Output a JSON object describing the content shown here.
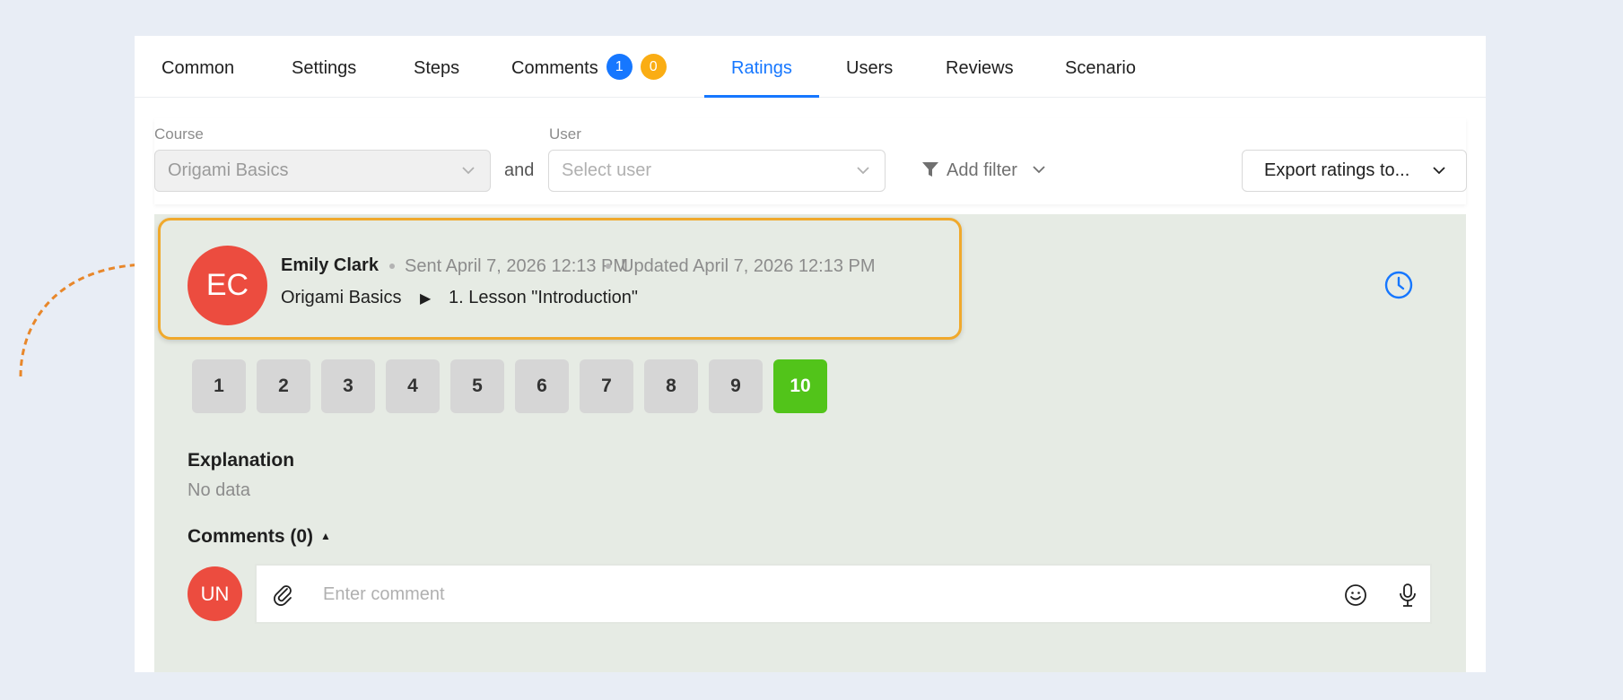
{
  "tabs": [
    {
      "label": "Common"
    },
    {
      "label": "Settings"
    },
    {
      "label": "Steps"
    },
    {
      "label": "Comments",
      "badges": [
        "1",
        "0"
      ]
    },
    {
      "label": "Ratings",
      "active": true
    },
    {
      "label": "Users"
    },
    {
      "label": "Reviews"
    },
    {
      "label": "Scenario"
    }
  ],
  "filters": {
    "course_label": "Course",
    "course_value": "Origami Basics",
    "and_label": "and",
    "user_label": "User",
    "user_placeholder": "Select user",
    "add_filter_label": "Add filter",
    "export_label": "Export ratings to..."
  },
  "rating": {
    "avatar_initials": "EC",
    "author": "Emily Clark",
    "sent": "Sent April 7, 2026 12:13 PM",
    "updated": "Updated April 7, 2026 12:13 PM",
    "course": "Origami Basics",
    "lesson": "1. Lesson \"Introduction\"",
    "scores": [
      "1",
      "2",
      "3",
      "4",
      "5",
      "6",
      "7",
      "8",
      "9",
      "10"
    ],
    "selected_score": "10",
    "explanation_title": "Explanation",
    "explanation_value": "No data",
    "comments_title": "Comments (0)"
  },
  "comment_input": {
    "avatar_initials": "UN",
    "placeholder": "Enter comment"
  },
  "colors": {
    "accent": "#1677ff",
    "badge_orange": "#faad14",
    "selected_score": "#52c41a",
    "avatar": "#ec4c3f",
    "highlight": "#f0a92c"
  }
}
